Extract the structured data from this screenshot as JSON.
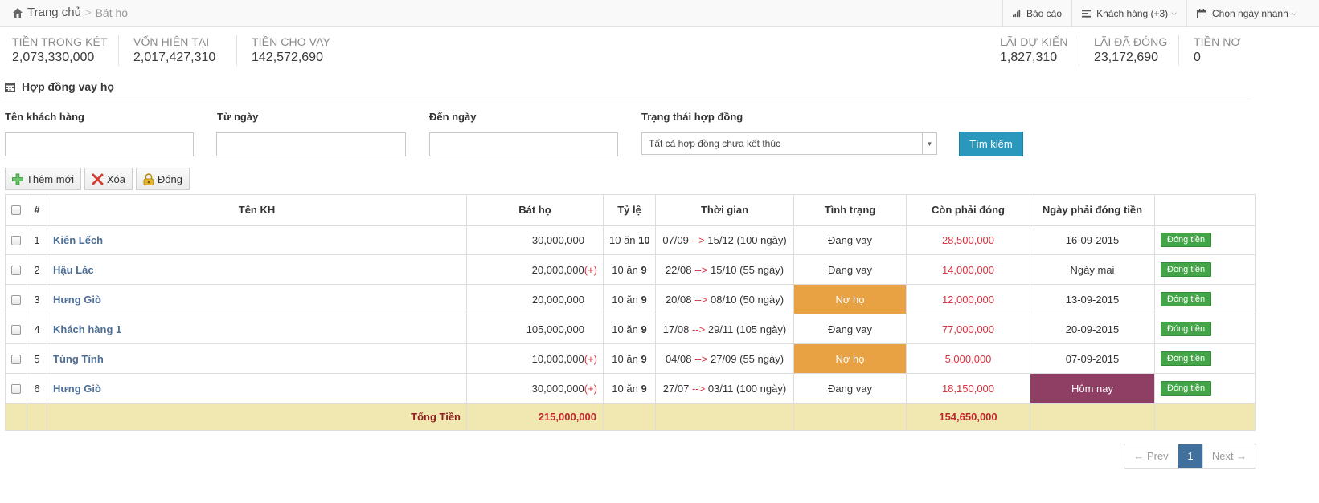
{
  "breadcrumb": {
    "home": "Trang chủ",
    "separator": ">",
    "current": "Bát họ"
  },
  "topbar": {
    "report": "Báo cáo",
    "customers": "Khách hàng (+3)",
    "quick_date": "Chọn ngày nhanh"
  },
  "stats": [
    {
      "label": "TIỀN TRONG KÉT",
      "value": "2,073,330,000"
    },
    {
      "label": "VỐN HIỆN TẠI",
      "value": "2,017,427,310"
    },
    {
      "label": "TIỀN CHO VAY",
      "value": "142,572,690"
    },
    {
      "label": "LÃI DỰ KIẾN",
      "value": "1,827,310"
    },
    {
      "label": "LÃI ĐÃ ĐÓNG",
      "value": "23,172,690"
    },
    {
      "label": "TIỀN NỢ",
      "value": "0"
    }
  ],
  "section": {
    "title": "Hợp đồng vay họ"
  },
  "filters": {
    "customer_label": "Tên khách hàng",
    "customer_value": "",
    "from_label": "Từ ngày",
    "from_value": "",
    "to_label": "Đến ngày",
    "to_value": "",
    "status_label": "Trạng thái hợp đồng",
    "status_value": "Tất cả hợp đồng chưa kết thúc",
    "search_button": "Tìm kiếm"
  },
  "actions": {
    "add": "Thêm mới",
    "delete": "Xóa",
    "close": "Đóng"
  },
  "table": {
    "headers": {
      "index": "#",
      "name": "Tên KH",
      "amount": "Bát họ",
      "rate": "Tỷ lệ",
      "time": "Thời gian",
      "status": "Tình trạng",
      "remaining": "Còn phải đóng",
      "due": "Ngày phải đóng tiền"
    },
    "arrow": "-->",
    "plus": "(+)",
    "pay_label": "Đóng tiền",
    "rows": [
      {
        "no": "1",
        "name": "Kiên Lếch",
        "amount": "30,000,000",
        "plus": false,
        "rate_prefix": "10 ăn",
        "rate_value": "10",
        "start": "07/09",
        "end": "15/12 (100 ngày)",
        "status": "Đang vay",
        "status_type": "normal",
        "remaining": "28,500,000",
        "due": "16-09-2015",
        "due_type": "normal"
      },
      {
        "no": "2",
        "name": "Hậu Lác",
        "amount": "20,000,000",
        "plus": true,
        "rate_prefix": "10 ăn",
        "rate_value": "9",
        "start": "22/08",
        "end": "15/10 (55 ngày)",
        "status": "Đang vay",
        "status_type": "normal",
        "remaining": "14,000,000",
        "due": "Ngày mai",
        "due_type": "normal"
      },
      {
        "no": "3",
        "name": "Hưng Giò",
        "amount": "20,000,000",
        "plus": false,
        "rate_prefix": "10 ăn",
        "rate_value": "9",
        "start": "20/08",
        "end": "08/10 (50 ngày)",
        "status": "Nợ họ",
        "status_type": "warn",
        "remaining": "12,000,000",
        "due": "13-09-2015",
        "due_type": "normal"
      },
      {
        "no": "4",
        "name": "Khách hàng 1",
        "amount": "105,000,000",
        "plus": false,
        "rate_prefix": "10 ăn",
        "rate_value": "9",
        "start": "17/08",
        "end": "29/11 (105 ngày)",
        "status": "Đang vay",
        "status_type": "normal",
        "remaining": "77,000,000",
        "due": "20-09-2015",
        "due_type": "normal"
      },
      {
        "no": "5",
        "name": "Tùng Tính",
        "amount": "10,000,000",
        "plus": true,
        "rate_prefix": "10 ăn",
        "rate_value": "9",
        "start": "04/08",
        "end": "27/09 (55 ngày)",
        "status": "Nợ họ",
        "status_type": "warn",
        "remaining": "5,000,000",
        "due": "07-09-2015",
        "due_type": "normal"
      },
      {
        "no": "6",
        "name": "Hưng Giò",
        "amount": "30,000,000",
        "plus": true,
        "rate_prefix": "10 ăn",
        "rate_value": "9",
        "start": "27/07",
        "end": "03/11 (100 ngày)",
        "status": "Đang vay",
        "status_type": "normal",
        "remaining": "18,150,000",
        "due": "Hôm nay",
        "due_type": "today"
      }
    ],
    "total": {
      "label": "Tổng Tiền",
      "amount": "215,000,000",
      "remaining": "154,650,000"
    }
  },
  "pagination": {
    "prev": "← Prev",
    "current": "1",
    "next": "Next →"
  },
  "colors": {
    "primary": "#2a98bd",
    "warning": "#e8a244",
    "today": "#8e3f63",
    "pay": "#43a547",
    "total_bg": "#f0e8b0",
    "amount_red": "#d9333f",
    "link": "#4d6f96",
    "page_active": "#41709d"
  },
  "icons": {
    "home": "home-icon",
    "report": "signal-icon",
    "customers": "list-icon",
    "date": "calendar-icon",
    "section": "calendar-icon",
    "add": "plus-icon",
    "delete": "x-icon",
    "close": "lock-icon"
  }
}
